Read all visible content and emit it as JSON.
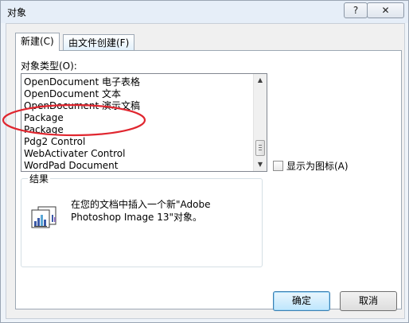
{
  "window": {
    "title": "对象",
    "help_glyph": "?",
    "close_glyph": "✕"
  },
  "tabs": [
    {
      "label": "新建(C)",
      "active": true
    },
    {
      "label": "由文件创建(F)",
      "active": false
    }
  ],
  "object_type": {
    "label": "对象类型(O):",
    "items": [
      "OpenDocument 电子表格",
      "OpenDocument 文本",
      "OpenDocument 演示文稿",
      "Package",
      "Package",
      "Pdg2 Control",
      "WebActivater Control",
      "WordPad Document"
    ],
    "annotation_color": "#e0262f"
  },
  "display_as_icon": {
    "label": "显示为图标(A)",
    "checked": false
  },
  "result": {
    "title": "结果",
    "text": "在您的文档中插入一个新\"Adobe Photoshop Image 13\"对象。"
  },
  "buttons": {
    "ok": "确定",
    "cancel": "取消"
  }
}
